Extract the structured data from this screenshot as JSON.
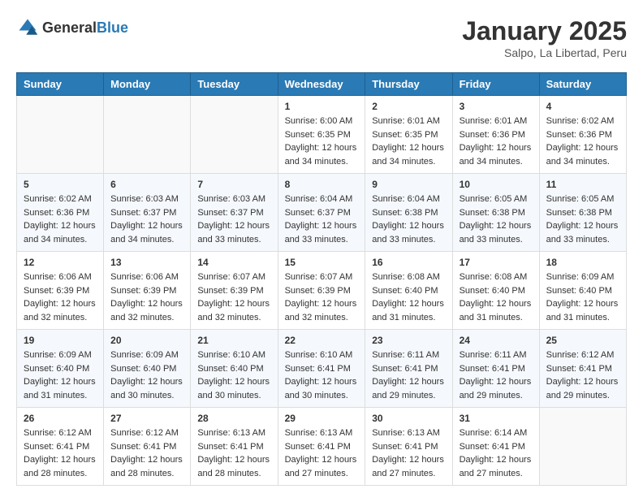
{
  "header": {
    "logo_general": "General",
    "logo_blue": "Blue",
    "month_year": "January 2025",
    "location": "Salpo, La Libertad, Peru"
  },
  "days_of_week": [
    "Sunday",
    "Monday",
    "Tuesday",
    "Wednesday",
    "Thursday",
    "Friday",
    "Saturday"
  ],
  "weeks": [
    [
      {
        "day": "",
        "info": ""
      },
      {
        "day": "",
        "info": ""
      },
      {
        "day": "",
        "info": ""
      },
      {
        "day": "1",
        "info": "Sunrise: 6:00 AM\nSunset: 6:35 PM\nDaylight: 12 hours\nand 34 minutes."
      },
      {
        "day": "2",
        "info": "Sunrise: 6:01 AM\nSunset: 6:35 PM\nDaylight: 12 hours\nand 34 minutes."
      },
      {
        "day": "3",
        "info": "Sunrise: 6:01 AM\nSunset: 6:36 PM\nDaylight: 12 hours\nand 34 minutes."
      },
      {
        "day": "4",
        "info": "Sunrise: 6:02 AM\nSunset: 6:36 PM\nDaylight: 12 hours\nand 34 minutes."
      }
    ],
    [
      {
        "day": "5",
        "info": "Sunrise: 6:02 AM\nSunset: 6:36 PM\nDaylight: 12 hours\nand 34 minutes."
      },
      {
        "day": "6",
        "info": "Sunrise: 6:03 AM\nSunset: 6:37 PM\nDaylight: 12 hours\nand 34 minutes."
      },
      {
        "day": "7",
        "info": "Sunrise: 6:03 AM\nSunset: 6:37 PM\nDaylight: 12 hours\nand 33 minutes."
      },
      {
        "day": "8",
        "info": "Sunrise: 6:04 AM\nSunset: 6:37 PM\nDaylight: 12 hours\nand 33 minutes."
      },
      {
        "day": "9",
        "info": "Sunrise: 6:04 AM\nSunset: 6:38 PM\nDaylight: 12 hours\nand 33 minutes."
      },
      {
        "day": "10",
        "info": "Sunrise: 6:05 AM\nSunset: 6:38 PM\nDaylight: 12 hours\nand 33 minutes."
      },
      {
        "day": "11",
        "info": "Sunrise: 6:05 AM\nSunset: 6:38 PM\nDaylight: 12 hours\nand 33 minutes."
      }
    ],
    [
      {
        "day": "12",
        "info": "Sunrise: 6:06 AM\nSunset: 6:39 PM\nDaylight: 12 hours\nand 32 minutes."
      },
      {
        "day": "13",
        "info": "Sunrise: 6:06 AM\nSunset: 6:39 PM\nDaylight: 12 hours\nand 32 minutes."
      },
      {
        "day": "14",
        "info": "Sunrise: 6:07 AM\nSunset: 6:39 PM\nDaylight: 12 hours\nand 32 minutes."
      },
      {
        "day": "15",
        "info": "Sunrise: 6:07 AM\nSunset: 6:39 PM\nDaylight: 12 hours\nand 32 minutes."
      },
      {
        "day": "16",
        "info": "Sunrise: 6:08 AM\nSunset: 6:40 PM\nDaylight: 12 hours\nand 31 minutes."
      },
      {
        "day": "17",
        "info": "Sunrise: 6:08 AM\nSunset: 6:40 PM\nDaylight: 12 hours\nand 31 minutes."
      },
      {
        "day": "18",
        "info": "Sunrise: 6:09 AM\nSunset: 6:40 PM\nDaylight: 12 hours\nand 31 minutes."
      }
    ],
    [
      {
        "day": "19",
        "info": "Sunrise: 6:09 AM\nSunset: 6:40 PM\nDaylight: 12 hours\nand 31 minutes."
      },
      {
        "day": "20",
        "info": "Sunrise: 6:09 AM\nSunset: 6:40 PM\nDaylight: 12 hours\nand 30 minutes."
      },
      {
        "day": "21",
        "info": "Sunrise: 6:10 AM\nSunset: 6:40 PM\nDaylight: 12 hours\nand 30 minutes."
      },
      {
        "day": "22",
        "info": "Sunrise: 6:10 AM\nSunset: 6:41 PM\nDaylight: 12 hours\nand 30 minutes."
      },
      {
        "day": "23",
        "info": "Sunrise: 6:11 AM\nSunset: 6:41 PM\nDaylight: 12 hours\nand 29 minutes."
      },
      {
        "day": "24",
        "info": "Sunrise: 6:11 AM\nSunset: 6:41 PM\nDaylight: 12 hours\nand 29 minutes."
      },
      {
        "day": "25",
        "info": "Sunrise: 6:12 AM\nSunset: 6:41 PM\nDaylight: 12 hours\nand 29 minutes."
      }
    ],
    [
      {
        "day": "26",
        "info": "Sunrise: 6:12 AM\nSunset: 6:41 PM\nDaylight: 12 hours\nand 28 minutes."
      },
      {
        "day": "27",
        "info": "Sunrise: 6:12 AM\nSunset: 6:41 PM\nDaylight: 12 hours\nand 28 minutes."
      },
      {
        "day": "28",
        "info": "Sunrise: 6:13 AM\nSunset: 6:41 PM\nDaylight: 12 hours\nand 28 minutes."
      },
      {
        "day": "29",
        "info": "Sunrise: 6:13 AM\nSunset: 6:41 PM\nDaylight: 12 hours\nand 27 minutes."
      },
      {
        "day": "30",
        "info": "Sunrise: 6:13 AM\nSunset: 6:41 PM\nDaylight: 12 hours\nand 27 minutes."
      },
      {
        "day": "31",
        "info": "Sunrise: 6:14 AM\nSunset: 6:41 PM\nDaylight: 12 hours\nand 27 minutes."
      },
      {
        "day": "",
        "info": ""
      }
    ]
  ]
}
